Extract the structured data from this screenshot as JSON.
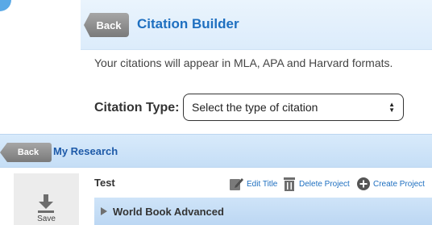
{
  "citation_builder": {
    "back_label": "Back",
    "title": "Citation Builder",
    "description": "Your citations will appear in MLA, APA and Harvard formats.",
    "citation_type_label": "Citation Type:",
    "citation_type_select": "Select the type of citation"
  },
  "my_research": {
    "back_label": "Back",
    "title": "My Research",
    "save_label": "Save",
    "project_name": "Test",
    "actions": {
      "edit": "Edit Title",
      "delete": "Delete Project",
      "create": "Create Project"
    },
    "source_group": "World Book Advanced"
  },
  "colors": {
    "accent": "#1e6fc0",
    "header_bg": "#dcecfb",
    "back_button": "#8c8c8c"
  },
  "icons": [
    "download-icon",
    "pencil-icon",
    "trash-icon",
    "plus-circle-icon",
    "triangle-right-icon",
    "updown-arrows-icon"
  ]
}
